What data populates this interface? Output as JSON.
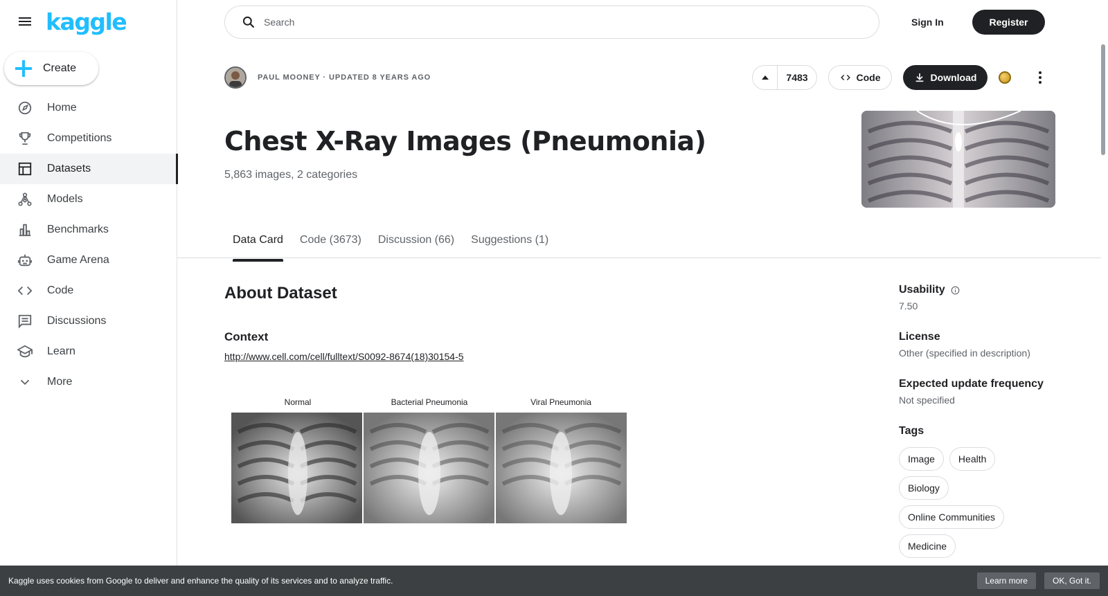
{
  "brand": {
    "logo_text": "kaggle",
    "accent": "#20beff"
  },
  "sidebar": {
    "create_label": "Create",
    "items": [
      {
        "label": "Home",
        "icon": "compass-icon"
      },
      {
        "label": "Competitions",
        "icon": "trophy-icon"
      },
      {
        "label": "Datasets",
        "icon": "table-icon",
        "active": true
      },
      {
        "label": "Models",
        "icon": "models-icon"
      },
      {
        "label": "Benchmarks",
        "icon": "bar-chart-icon"
      },
      {
        "label": "Game Arena",
        "icon": "robot-icon"
      },
      {
        "label": "Code",
        "icon": "code-icon"
      },
      {
        "label": "Discussions",
        "icon": "comment-icon"
      },
      {
        "label": "Learn",
        "icon": "school-icon"
      },
      {
        "label": "More",
        "icon": "chevron-down-icon"
      }
    ]
  },
  "header": {
    "search_placeholder": "Search",
    "signin_label": "Sign In",
    "register_label": "Register"
  },
  "dataset": {
    "author_line": "PAUL MOONEY · UPDATED 8 YEARS AGO",
    "vote_count": "7483",
    "code_label": "Code",
    "download_label": "Download",
    "title": "Chest X-Ray Images (Pneumonia)",
    "subtitle": "5,863 images, 2 categories"
  },
  "tabs": [
    {
      "label": "Data Card",
      "active": true
    },
    {
      "label": "Code (3673)"
    },
    {
      "label": "Discussion (66)"
    },
    {
      "label": "Suggestions (1)"
    }
  ],
  "main": {
    "about_heading": "About Dataset",
    "context_heading": "Context",
    "context_link": "http://www.cell.com/cell/fulltext/S0092-8674(18)30154-5",
    "figure_labels": [
      "Normal",
      "Bacterial Pneumonia",
      "Viral Pneumonia"
    ]
  },
  "side": {
    "usability_label": "Usability",
    "usability_value": "7.50",
    "license_label": "License",
    "license_value": "Other (specified in description)",
    "frequency_label": "Expected update frequency",
    "frequency_value": "Not specified",
    "tags_label": "Tags",
    "tags": [
      "Image",
      "Health",
      "Biology",
      "Online Communities",
      "Medicine"
    ]
  },
  "cookie": {
    "message": "Kaggle uses cookies from Google to deliver and enhance the quality of its services and to analyze traffic.",
    "learn_more": "Learn more",
    "ok": "OK, Got it."
  }
}
